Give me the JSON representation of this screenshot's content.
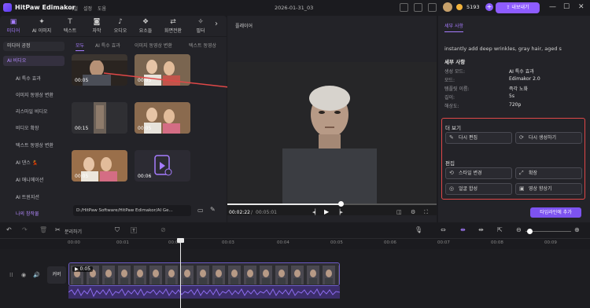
{
  "app": {
    "title": "HitPaw Edimakor",
    "menu": [
      "파일",
      "설정",
      "도움"
    ],
    "project": "2026-01-31_03",
    "credits": "5193",
    "export_label": "내보내기"
  },
  "tools": [
    {
      "label": "미디어",
      "icon": "media"
    },
    {
      "label": "AI 이미지",
      "icon": "ai-image"
    },
    {
      "label": "텍스트",
      "icon": "text"
    },
    {
      "label": "자막",
      "icon": "subtitle"
    },
    {
      "label": "오디오",
      "icon": "audio"
    },
    {
      "label": "요소들",
      "icon": "elements"
    },
    {
      "label": "화면전환",
      "icon": "transition"
    },
    {
      "label": "필터",
      "icon": "filter"
    }
  ],
  "sidebar": {
    "header": "미디어 공정",
    "selected": "AI 비디오",
    "items": [
      "AI 특수 효과",
      "이미지 동영상 변환",
      "리스마일 비디오",
      "비디오 확장",
      "텍스트 동영상 변환",
      "AI 댄스 💃",
      "AI 애니메이션",
      "AI 트윈지션",
      "나의 창작물"
    ]
  },
  "media": {
    "tabs": [
      "모두",
      "AI 특수 효과",
      "이미지 동영상 변환",
      "텍스트 동영상"
    ],
    "thumbs": [
      {
        "duration": "00:05"
      },
      {
        "duration": "00:05"
      },
      {
        "duration": "00:15"
      },
      {
        "duration": "00:05"
      },
      {
        "duration": "00:05"
      },
      {
        "duration": "00:06"
      }
    ],
    "path": "D:/HitPaw Software/HitPaw Edimakor/AI Ge..."
  },
  "player": {
    "title": "플레이어",
    "current": "00:02:22",
    "total": "00:05:01",
    "progress": 0.54
  },
  "right": {
    "tab": "세부 사항",
    "prompt": "instantly add deep wrinkles, gray hair, aged s",
    "details_header": "세부 사항",
    "details": [
      {
        "k": "생성 모드:",
        "v": "AI 특수 효과"
      },
      {
        "k": "모드:",
        "v": "Edimakor 2.0"
      },
      {
        "k": "템플릿 이름:",
        "v": "즉각 노화"
      },
      {
        "k": "길이:",
        "v": "5s"
      },
      {
        "k": "해상도:",
        "v": "720p"
      }
    ],
    "more_header": "더 보기",
    "edit_again": "다시 편집",
    "regenerate": "다시 생성하기",
    "edit_header": "편집",
    "style_change": "스타일 변경",
    "expand": "확장",
    "face_compose": "얼굴 합성",
    "video_enhance": "영상 향상기",
    "add_to_timeline": "타임라인에 추가"
  },
  "timeline": {
    "split_label": "분리하기",
    "ticks": [
      "00:00",
      "00:01",
      "00:02",
      "00:03",
      "00:04",
      "00:05",
      "00:06",
      "00:07",
      "00:08",
      "00:09"
    ],
    "cover_label": "커버",
    "clip_duration": "0:05"
  }
}
